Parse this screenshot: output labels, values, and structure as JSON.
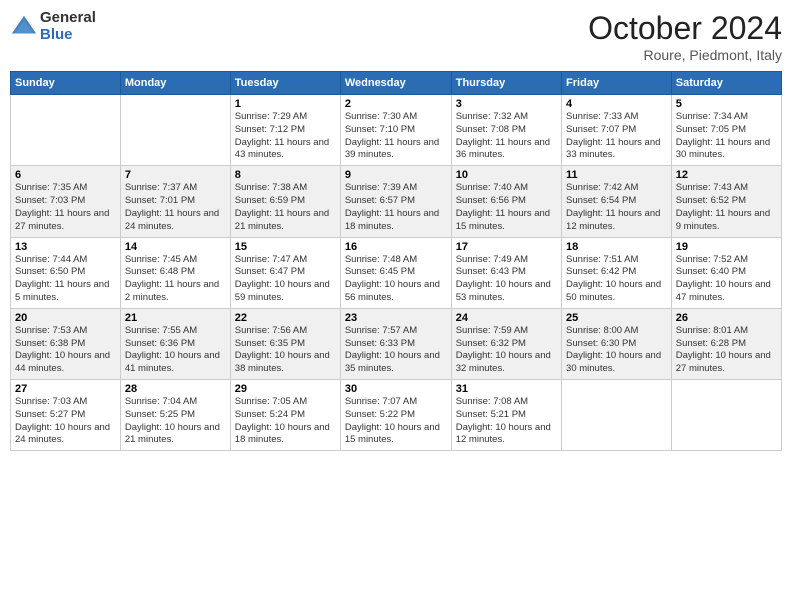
{
  "header": {
    "logo_general": "General",
    "logo_blue": "Blue",
    "title": "October 2024",
    "location": "Roure, Piedmont, Italy"
  },
  "days_of_week": [
    "Sunday",
    "Monday",
    "Tuesday",
    "Wednesday",
    "Thursday",
    "Friday",
    "Saturday"
  ],
  "weeks": [
    [
      {
        "day": "",
        "sunrise": "",
        "sunset": "",
        "daylight": ""
      },
      {
        "day": "",
        "sunrise": "",
        "sunset": "",
        "daylight": ""
      },
      {
        "day": "1",
        "sunrise": "Sunrise: 7:29 AM",
        "sunset": "Sunset: 7:12 PM",
        "daylight": "Daylight: 11 hours and 43 minutes."
      },
      {
        "day": "2",
        "sunrise": "Sunrise: 7:30 AM",
        "sunset": "Sunset: 7:10 PM",
        "daylight": "Daylight: 11 hours and 39 minutes."
      },
      {
        "day": "3",
        "sunrise": "Sunrise: 7:32 AM",
        "sunset": "Sunset: 7:08 PM",
        "daylight": "Daylight: 11 hours and 36 minutes."
      },
      {
        "day": "4",
        "sunrise": "Sunrise: 7:33 AM",
        "sunset": "Sunset: 7:07 PM",
        "daylight": "Daylight: 11 hours and 33 minutes."
      },
      {
        "day": "5",
        "sunrise": "Sunrise: 7:34 AM",
        "sunset": "Sunset: 7:05 PM",
        "daylight": "Daylight: 11 hours and 30 minutes."
      }
    ],
    [
      {
        "day": "6",
        "sunrise": "Sunrise: 7:35 AM",
        "sunset": "Sunset: 7:03 PM",
        "daylight": "Daylight: 11 hours and 27 minutes."
      },
      {
        "day": "7",
        "sunrise": "Sunrise: 7:37 AM",
        "sunset": "Sunset: 7:01 PM",
        "daylight": "Daylight: 11 hours and 24 minutes."
      },
      {
        "day": "8",
        "sunrise": "Sunrise: 7:38 AM",
        "sunset": "Sunset: 6:59 PM",
        "daylight": "Daylight: 11 hours and 21 minutes."
      },
      {
        "day": "9",
        "sunrise": "Sunrise: 7:39 AM",
        "sunset": "Sunset: 6:57 PM",
        "daylight": "Daylight: 11 hours and 18 minutes."
      },
      {
        "day": "10",
        "sunrise": "Sunrise: 7:40 AM",
        "sunset": "Sunset: 6:56 PM",
        "daylight": "Daylight: 11 hours and 15 minutes."
      },
      {
        "day": "11",
        "sunrise": "Sunrise: 7:42 AM",
        "sunset": "Sunset: 6:54 PM",
        "daylight": "Daylight: 11 hours and 12 minutes."
      },
      {
        "day": "12",
        "sunrise": "Sunrise: 7:43 AM",
        "sunset": "Sunset: 6:52 PM",
        "daylight": "Daylight: 11 hours and 9 minutes."
      }
    ],
    [
      {
        "day": "13",
        "sunrise": "Sunrise: 7:44 AM",
        "sunset": "Sunset: 6:50 PM",
        "daylight": "Daylight: 11 hours and 5 minutes."
      },
      {
        "day": "14",
        "sunrise": "Sunrise: 7:45 AM",
        "sunset": "Sunset: 6:48 PM",
        "daylight": "Daylight: 11 hours and 2 minutes."
      },
      {
        "day": "15",
        "sunrise": "Sunrise: 7:47 AM",
        "sunset": "Sunset: 6:47 PM",
        "daylight": "Daylight: 10 hours and 59 minutes."
      },
      {
        "day": "16",
        "sunrise": "Sunrise: 7:48 AM",
        "sunset": "Sunset: 6:45 PM",
        "daylight": "Daylight: 10 hours and 56 minutes."
      },
      {
        "day": "17",
        "sunrise": "Sunrise: 7:49 AM",
        "sunset": "Sunset: 6:43 PM",
        "daylight": "Daylight: 10 hours and 53 minutes."
      },
      {
        "day": "18",
        "sunrise": "Sunrise: 7:51 AM",
        "sunset": "Sunset: 6:42 PM",
        "daylight": "Daylight: 10 hours and 50 minutes."
      },
      {
        "day": "19",
        "sunrise": "Sunrise: 7:52 AM",
        "sunset": "Sunset: 6:40 PM",
        "daylight": "Daylight: 10 hours and 47 minutes."
      }
    ],
    [
      {
        "day": "20",
        "sunrise": "Sunrise: 7:53 AM",
        "sunset": "Sunset: 6:38 PM",
        "daylight": "Daylight: 10 hours and 44 minutes."
      },
      {
        "day": "21",
        "sunrise": "Sunrise: 7:55 AM",
        "sunset": "Sunset: 6:36 PM",
        "daylight": "Daylight: 10 hours and 41 minutes."
      },
      {
        "day": "22",
        "sunrise": "Sunrise: 7:56 AM",
        "sunset": "Sunset: 6:35 PM",
        "daylight": "Daylight: 10 hours and 38 minutes."
      },
      {
        "day": "23",
        "sunrise": "Sunrise: 7:57 AM",
        "sunset": "Sunset: 6:33 PM",
        "daylight": "Daylight: 10 hours and 35 minutes."
      },
      {
        "day": "24",
        "sunrise": "Sunrise: 7:59 AM",
        "sunset": "Sunset: 6:32 PM",
        "daylight": "Daylight: 10 hours and 32 minutes."
      },
      {
        "day": "25",
        "sunrise": "Sunrise: 8:00 AM",
        "sunset": "Sunset: 6:30 PM",
        "daylight": "Daylight: 10 hours and 30 minutes."
      },
      {
        "day": "26",
        "sunrise": "Sunrise: 8:01 AM",
        "sunset": "Sunset: 6:28 PM",
        "daylight": "Daylight: 10 hours and 27 minutes."
      }
    ],
    [
      {
        "day": "27",
        "sunrise": "Sunrise: 7:03 AM",
        "sunset": "Sunset: 5:27 PM",
        "daylight": "Daylight: 10 hours and 24 minutes."
      },
      {
        "day": "28",
        "sunrise": "Sunrise: 7:04 AM",
        "sunset": "Sunset: 5:25 PM",
        "daylight": "Daylight: 10 hours and 21 minutes."
      },
      {
        "day": "29",
        "sunrise": "Sunrise: 7:05 AM",
        "sunset": "Sunset: 5:24 PM",
        "daylight": "Daylight: 10 hours and 18 minutes."
      },
      {
        "day": "30",
        "sunrise": "Sunrise: 7:07 AM",
        "sunset": "Sunset: 5:22 PM",
        "daylight": "Daylight: 10 hours and 15 minutes."
      },
      {
        "day": "31",
        "sunrise": "Sunrise: 7:08 AM",
        "sunset": "Sunset: 5:21 PM",
        "daylight": "Daylight: 10 hours and 12 minutes."
      },
      {
        "day": "",
        "sunrise": "",
        "sunset": "",
        "daylight": ""
      },
      {
        "day": "",
        "sunrise": "",
        "sunset": "",
        "daylight": ""
      }
    ]
  ]
}
